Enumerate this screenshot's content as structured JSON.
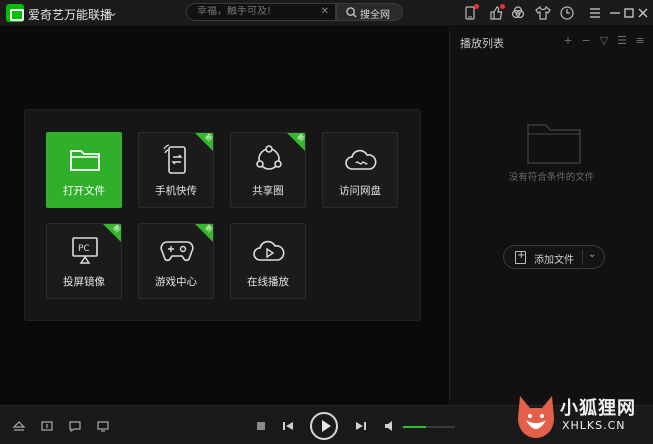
{
  "app": {
    "title": "爱奇艺万能联播",
    "accent": "#00be06"
  },
  "search": {
    "placeholder": "幸福，触手可及!",
    "button_label": "搜全网"
  },
  "titlebar_icons": [
    "phone-transfer-icon",
    "thumbs-up-icon",
    "skin-icon",
    "shirt-icon",
    "history-clock-icon"
  ],
  "window_controls": [
    "menu-icon",
    "minimize-icon",
    "maximize-icon",
    "close-icon"
  ],
  "tiles": [
    {
      "name": "open-file",
      "label": "打开文件",
      "icon": "folder-icon",
      "active": true,
      "badge": ""
    },
    {
      "name": "phone-transfer",
      "label": "手机快传",
      "icon": "phone-transfer-icon",
      "active": false,
      "badge": "新"
    },
    {
      "name": "share-circle",
      "label": "共享圈",
      "icon": "share-circle-icon",
      "active": false,
      "badge": "新"
    },
    {
      "name": "cloud-drive",
      "label": "访问网盘",
      "icon": "cloud-icon",
      "active": false,
      "badge": ""
    },
    {
      "name": "screen-mirror",
      "label": "投屏镜像",
      "icon": "pc-mirror-icon",
      "active": false,
      "badge": "新"
    },
    {
      "name": "game-center",
      "label": "游戏中心",
      "icon": "gamepad-icon",
      "active": false,
      "badge": "新"
    },
    {
      "name": "online-play",
      "label": "在线播放",
      "icon": "cloud-play-icon",
      "active": false,
      "badge": ""
    }
  ],
  "playlist": {
    "title": "播放列表",
    "actions": [
      "+",
      "−",
      "▽",
      "☰",
      "≡"
    ],
    "empty_text": "没有符合条件的文件",
    "add_file_label": "添加文件"
  },
  "controls": {
    "volume_level": 0.45,
    "volume_color": "#2bbf2b"
  },
  "watermark": {
    "text": "小狐狸网",
    "url": "XHLKS.CN"
  }
}
